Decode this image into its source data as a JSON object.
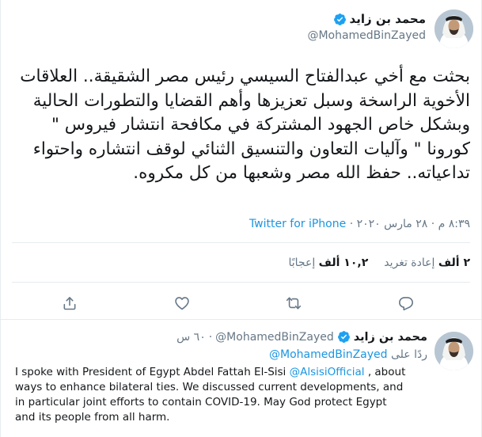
{
  "main_tweet": {
    "author_name": "محمد بن زايد",
    "author_handle": "@MohamedBinZayed",
    "text": "بحثت مع أخي عبدالفتاح السيسي رئيس مصر الشقيقة.. العلاقات الأخوية الراسخة وسبل تعزيزها وأهم القضايا والتطورات الحالية وبشكل خاص الجهود المشتركة في مكافحة انتشار فيروس \" كورونا \" وآليات التعاون والتنسيق الثنائي لوقف انتشاره واحتواء تداعياته.. حفظ الله مصر وشعبها من كل مكروه.",
    "timestamp": "٨:٣٩ م · ٢٨ مارس ٢٠٢٠",
    "source": "Twitter for iPhone",
    "retweets_count": "٢ ألف",
    "retweets_label": "إعادة تغريد",
    "likes_count": "١٠,٢ ألف",
    "likes_label": "إعجابًا"
  },
  "actions": {
    "reply_icon": "reply-icon",
    "retweet_icon": "retweet-icon",
    "like_icon": "heart-icon",
    "share_icon": "share-icon"
  },
  "reply_tweet": {
    "author_name": "محمد بن زايد",
    "author_handle": "@MohamedBinZayed",
    "time_ago": "٦٠ س",
    "replying_to_label": "ردًا على",
    "replying_to_handle": "@MohamedBinZayed",
    "text_before_mention": "I spoke with President of Egypt Abdel Fattah El-Sisi ",
    "mention": "@AlsisiOfficial",
    "text_after_mention": " , about ways to enhance bilateral ties. We discussed current developments, and in particular joint efforts to contain COVID-19. May God protect Egypt and its people from all harm."
  },
  "colors": {
    "link": "#1b95e0",
    "secondary_text": "#657786",
    "verified": "#1da1f2",
    "border": "#e6ecf0"
  }
}
